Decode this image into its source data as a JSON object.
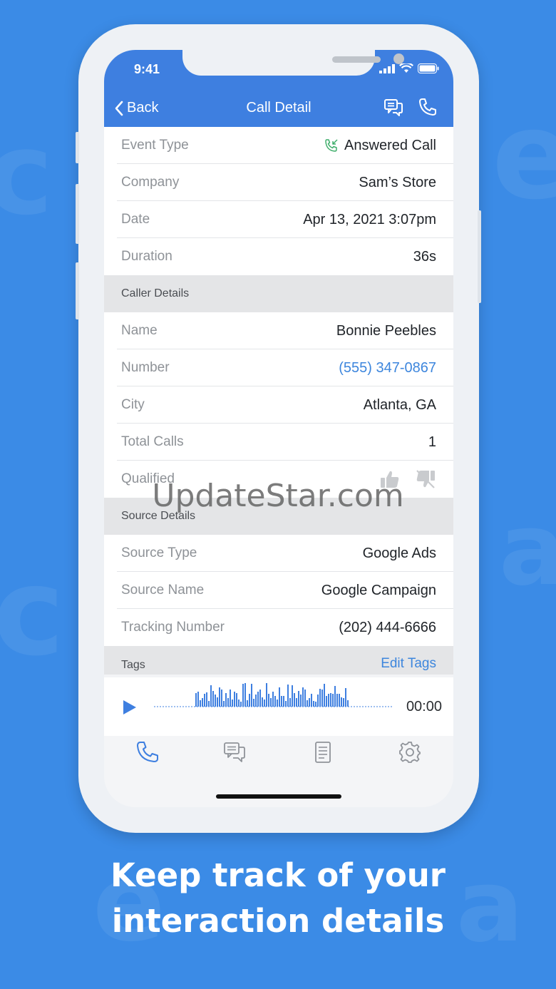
{
  "status_bar": {
    "time": "9:41"
  },
  "nav": {
    "back_label": "Back",
    "title": "Call Detail",
    "icons": [
      "chat-icon",
      "phone-icon"
    ]
  },
  "call_info": [
    {
      "label": "Event Type",
      "value": "Answered Call",
      "icon": "answered-call-icon"
    },
    {
      "label": "Company",
      "value": "Sam’s Store"
    },
    {
      "label": "Date",
      "value": "Apr 13, 2021 3:07pm"
    },
    {
      "label": "Duration",
      "value": "36s"
    }
  ],
  "caller_details": {
    "header": "Caller Details",
    "rows": [
      {
        "label": "Name",
        "value": "Bonnie Peebles"
      },
      {
        "label": "Number",
        "value": "(555) 347-0867"
      },
      {
        "label": "City",
        "value": "Atlanta, GA"
      },
      {
        "label": "Total Calls",
        "value": "1"
      },
      {
        "label": "Qualified",
        "icons": [
          "thumbs-up-icon",
          "thumbs-down-icon"
        ]
      }
    ]
  },
  "source_details": {
    "header": "Source Details",
    "rows": [
      {
        "label": "Source Type",
        "value": "Google Ads"
      },
      {
        "label": "Source Name",
        "value": "Google Campaign"
      },
      {
        "label": "Tracking Number",
        "value": "(202) 444-6666"
      }
    ]
  },
  "tags": {
    "header": "Tags",
    "edit_label": "Edit Tags"
  },
  "player": {
    "time": "00:00"
  },
  "tab_bar": [
    "calls-tab-icon",
    "messages-tab-icon",
    "forms-tab-icon",
    "settings-tab-icon"
  ],
  "watermark": "UpdateStar.com",
  "caption": {
    "line1": "Keep track of your",
    "line2": "interaction details"
  },
  "colors": {
    "background": "#3b8be6",
    "header": "#3e7fe0",
    "link": "#3d86dd"
  }
}
